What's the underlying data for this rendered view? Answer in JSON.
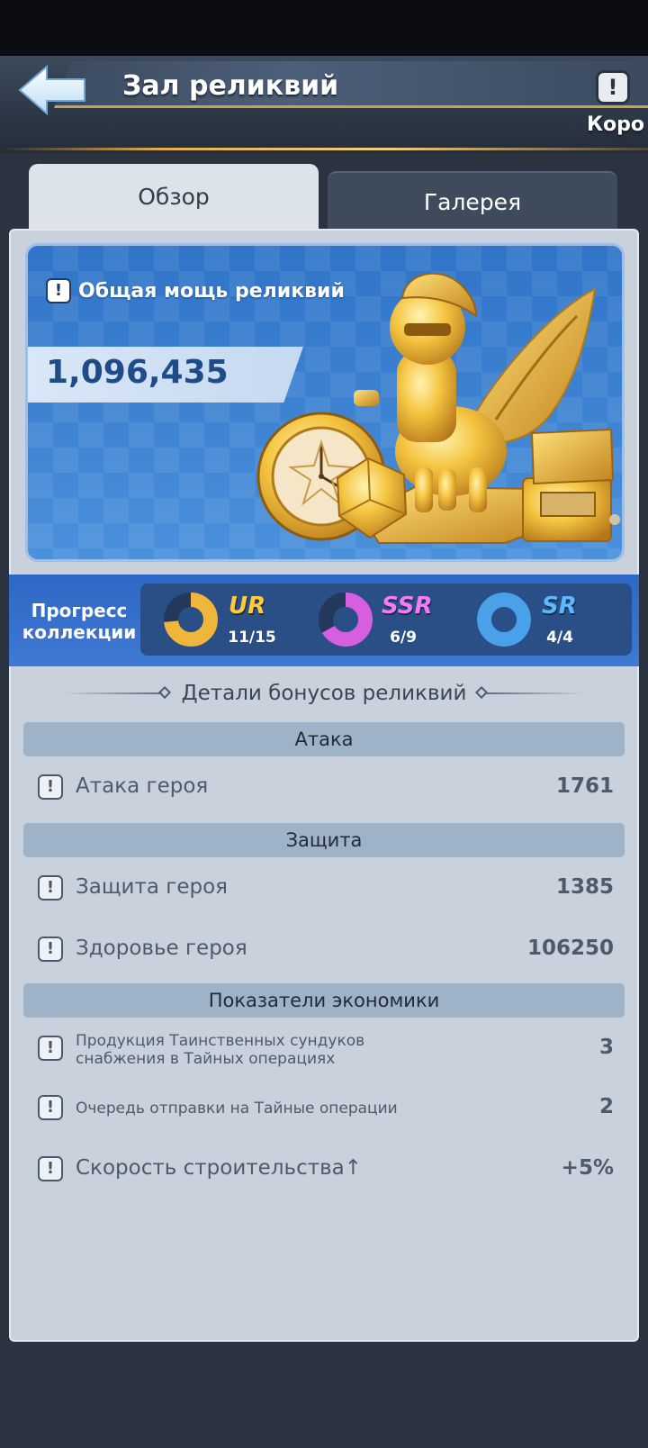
{
  "header": {
    "title": "Зал реликвий",
    "side_label": "Коро",
    "help_glyph": "!"
  },
  "tabs": [
    {
      "label": "Обзор",
      "selected": true
    },
    {
      "label": "Галерея",
      "selected": false
    }
  ],
  "power": {
    "label": "Общая мощь реликвий",
    "value": "1,096,435"
  },
  "collection": {
    "title": "Прогресс коллекции",
    "rarities": [
      {
        "name": "UR",
        "count": "11/15",
        "progress": 0.733,
        "color": "#f0b53b",
        "name_color": "#ffc93d"
      },
      {
        "name": "SSR",
        "count": "6/9",
        "progress": 0.667,
        "color": "#d65fe0",
        "name_color": "#f27cf5"
      },
      {
        "name": "SR",
        "count": "4/4",
        "progress": 1.0,
        "color": "#4aa1ea",
        "name_color": "#5bb9ff"
      }
    ]
  },
  "details": {
    "heading": "Детали бонусов реликвий",
    "sections": [
      {
        "title": "Атака",
        "rows": [
          {
            "label": "Атака героя",
            "value": "1761"
          }
        ]
      },
      {
        "title": "Защита",
        "rows": [
          {
            "label": "Защита героя",
            "value": "1385"
          },
          {
            "label": "Здоровье героя",
            "value": "106250"
          }
        ]
      },
      {
        "title": "Показатели экономики",
        "rows": [
          {
            "label": "Продукция Таинственных сундуков снабжения в Тайных операциях",
            "label_line1": "Продукция Таинственных сундуков",
            "label_line2": "снабжения в Тайных операциях",
            "value": "3"
          },
          {
            "label": "Очередь отправки на Тайные операции",
            "value": "2"
          },
          {
            "label": "Скорость строительства↑",
            "value": "+5%"
          }
        ]
      }
    ]
  },
  "icons": {
    "back": "back-arrow-icon",
    "info": "exclamation-icon"
  }
}
